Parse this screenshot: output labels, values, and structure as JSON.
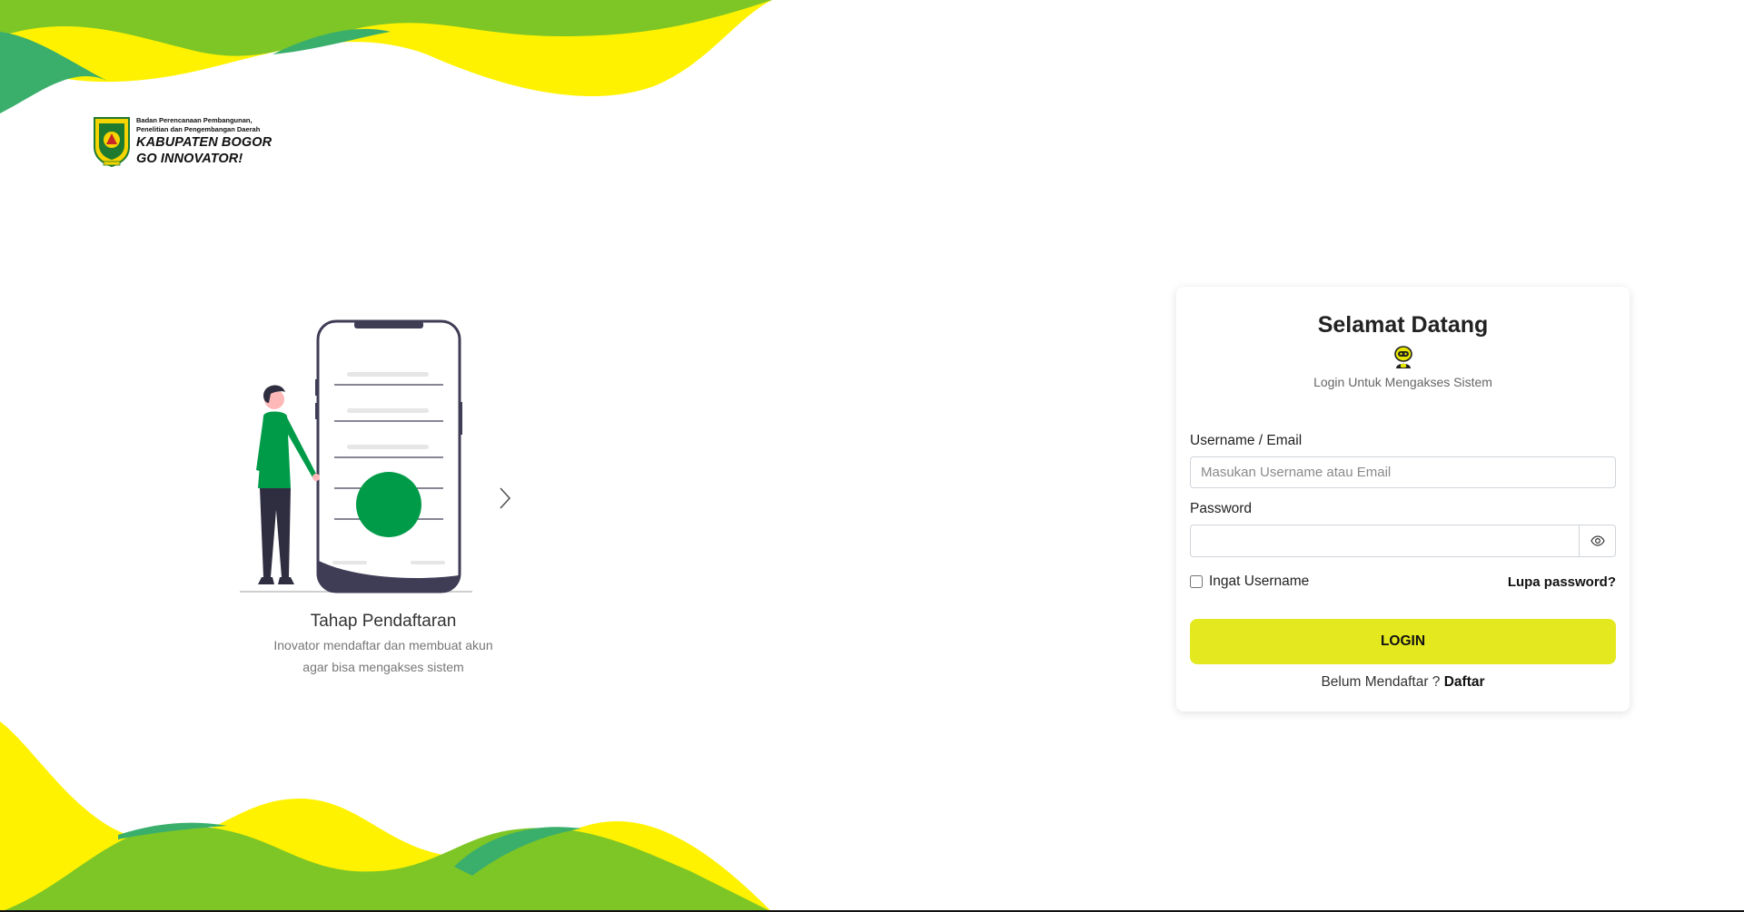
{
  "brand": {
    "org_line1": "Badan Perencanaan Pembangunan,",
    "org_line2": "Penelitian dan Pengembangan Daerah",
    "name_line1": "KABUPATEN BOGOR",
    "name_line2": "GO INNOVATOR!"
  },
  "slide": {
    "title": "Tahap Pendaftaran",
    "description_line1": "Inovator mendaftar dan membuat akun",
    "description_line2": "agar bisa mengakses sistem",
    "next_icon": "chevron-right-icon"
  },
  "login": {
    "title": "Selamat Datang",
    "mascot_icon": "robot-mascot-icon",
    "subtitle": "Login Untuk Mengakses Sistem",
    "username_label": "Username / Email",
    "username_placeholder": "Masukan Username atau Email",
    "username_value": "",
    "password_label": "Password",
    "password_value": "",
    "password_toggle_icon": "eye-icon",
    "remember_label": "Ingat Username",
    "remember_checked": false,
    "forgot_label": "Lupa password?",
    "button_label": "LOGIN",
    "register_prompt": "Belum Mendaftar ? ",
    "register_link": "Daftar"
  },
  "colors": {
    "lime": "#7ec626",
    "yellow": "#fff200",
    "teal": "#3aaf6c",
    "button": "#e4e81e",
    "accent_green": "#009b48"
  }
}
